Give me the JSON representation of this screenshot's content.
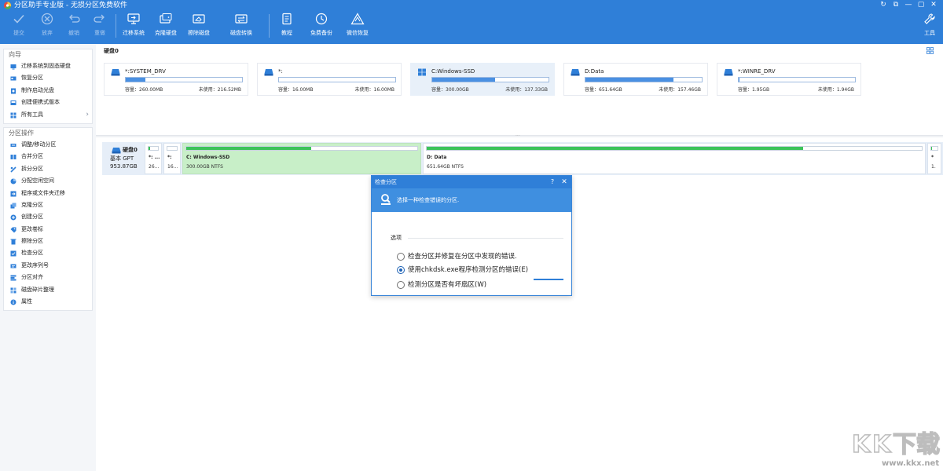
{
  "app": {
    "title": "分区助手专业版 - 无损分区免费软件",
    "window_buttons": [
      "↻",
      "⧉",
      "—",
      "▢",
      "✕"
    ]
  },
  "toolbar": {
    "disabled": [
      {
        "label": "提交",
        "icon": "check-icon"
      },
      {
        "label": "放弃",
        "icon": "cancel-icon"
      },
      {
        "label": "撤销",
        "icon": "undo-icon"
      },
      {
        "label": "重做",
        "icon": "redo-icon"
      }
    ],
    "group1": [
      {
        "label": "迁移系统",
        "icon": "migrate-os-icon"
      },
      {
        "label": "克隆硬盘",
        "icon": "clone-disk-icon"
      },
      {
        "label": "擦除磁盘",
        "icon": "wipe-disk-icon"
      },
      {
        "label": "磁盘转换",
        "icon": "convert-disk-icon"
      }
    ],
    "group2": [
      {
        "label": "教程",
        "icon": "tutorial-icon"
      },
      {
        "label": "免费备份",
        "icon": "free-backup-icon"
      },
      {
        "label": "微信恢复",
        "icon": "wechat-recovery-icon"
      }
    ],
    "tools": {
      "label": "工具",
      "icon": "wrench-icon"
    }
  },
  "sidebar": {
    "wizard_title": "向导",
    "wizard_items": [
      {
        "label": "迁移系统到固态硬盘",
        "icon": "migrate-ssd-icon"
      },
      {
        "label": "恢复分区",
        "icon": "restore-partition-icon"
      },
      {
        "label": "制作启动光盘",
        "icon": "boot-disc-icon"
      },
      {
        "label": "创建便携式版本",
        "icon": "portable-icon"
      },
      {
        "label": "所有工具",
        "icon": "all-tools-icon",
        "chevron": "›"
      }
    ],
    "ops_title": "分区操作",
    "ops_items": [
      {
        "label": "调整/移动分区",
        "icon": "resize-icon"
      },
      {
        "label": "合并分区",
        "icon": "merge-icon"
      },
      {
        "label": "拆分分区",
        "icon": "split-icon"
      },
      {
        "label": "分配空闲空间",
        "icon": "allocate-icon"
      },
      {
        "label": "程序或文件夹迁移",
        "icon": "app-move-icon"
      },
      {
        "label": "克隆分区",
        "icon": "clone-partition-icon"
      },
      {
        "label": "创建分区",
        "icon": "create-partition-icon"
      },
      {
        "label": "更改卷标",
        "icon": "label-icon"
      },
      {
        "label": "擦除分区",
        "icon": "wipe-partition-icon"
      },
      {
        "label": "检查分区",
        "icon": "check-partition-icon"
      },
      {
        "label": "更改序列号",
        "icon": "serial-icon"
      },
      {
        "label": "分区对齐",
        "icon": "align-icon"
      },
      {
        "label": "磁盘碎片整理",
        "icon": "defrag-icon"
      },
      {
        "label": "属性",
        "icon": "info-icon"
      }
    ]
  },
  "disk0": {
    "section_title": "硬盘0",
    "name": "硬盘0",
    "type": "基本 GPT",
    "size": "953.87GB",
    "partitions": [
      {
        "name": "*:SYSTEM_DRV",
        "capacity": "容量：260.00MB",
        "free": "未使用：216.52MB",
        "used": 0.17,
        "os": false
      },
      {
        "name": "*:",
        "capacity": "容量：16.00MB",
        "free": "未使用：16.00MB",
        "used": 0.0,
        "os": false
      },
      {
        "name": "C:Windows-SSD",
        "capacity": "容量：300.00GB",
        "free": "未使用：137.33GB",
        "used": 0.54,
        "os": true
      },
      {
        "name": "D:Data",
        "capacity": "容量：651.64GB",
        "free": "未使用：157.46GB",
        "used": 0.76,
        "os": false
      },
      {
        "name": "*:WINRE_DRV",
        "capacity": "容量：1.95GB",
        "free": "未使用：1.94GB",
        "used": 0.01,
        "os": false
      }
    ],
    "segments": [
      {
        "name": "*: ...",
        "sub": "26...",
        "used": 0.17
      },
      {
        "name": "*:",
        "sub": "16...",
        "used": 0.0
      },
      {
        "name": "C: Windows-SSD",
        "sub": "300.00GB NTFS",
        "used": 0.54
      },
      {
        "name": "D: Data",
        "sub": "651.64GB NTFS",
        "used": 0.76
      },
      {
        "name": "*",
        "sub": "1.",
        "used": 0.01
      }
    ]
  },
  "dialog": {
    "title": "检查分区",
    "help": "?",
    "close": "✕",
    "subtitle": "选择一种检查错误的分区.",
    "group_label": "选项",
    "options": [
      {
        "label": "检查分区并修复在分区中发现的错误.",
        "selected": false
      },
      {
        "label": "使用chkdsk.exe程序检测分区的错误(E)",
        "selected": true
      },
      {
        "label": "检测分区是否有坏扇区(W)",
        "selected": false
      }
    ]
  },
  "watermark": {
    "url": "www.kkx.net"
  },
  "colors": {
    "accent": "#2f7fd8",
    "usage_bar": "#4a90e2",
    "segment_fill": "#3cc35a",
    "selected_segment": "#c8efc8"
  }
}
